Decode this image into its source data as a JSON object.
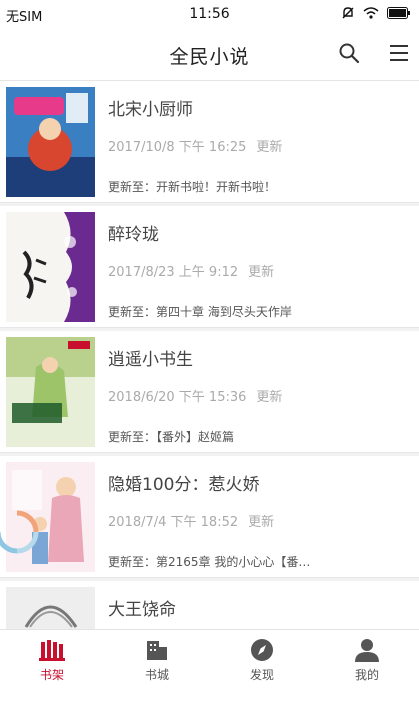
{
  "status_bar": {
    "carrier": "无SIM",
    "time": "11:56"
  },
  "header": {
    "title": "全民小说",
    "search_icon": "search-icon",
    "menu_icon": "menu-icon"
  },
  "books": [
    {
      "title": "北宋小厨师",
      "date": "2017/10/8 下午 16:25",
      "update_tag": "更新",
      "latest": "更新至：开新书啦！开新书啦！",
      "cover_color": "#d9462f"
    },
    {
      "title": "醉玲珑",
      "date": "2017/8/23 上午 9:12",
      "update_tag": "更新",
      "latest": "更新至：第四十章 海到尽头天作岸",
      "cover_color": "#6b2a8f"
    },
    {
      "title": "逍遥小书生",
      "date": "2018/6/20 下午 15:36",
      "update_tag": "更新",
      "latest": "更新至：【番外】赵姬篇",
      "cover_color": "#6f9a3a"
    },
    {
      "title": "隐婚100分：惹火娇",
      "date": "2018/7/4 下午 18:52",
      "update_tag": "更新",
      "latest": "更新至：第2165章 我的小心心【番…",
      "cover_color": "#e9a7b8"
    },
    {
      "title": "大王饶命",
      "date": "",
      "update_tag": "",
      "latest": "",
      "cover_color": "#cfcfcf"
    }
  ],
  "tabs": [
    {
      "label": "书架",
      "icon": "bookshelf-icon",
      "active": true
    },
    {
      "label": "书城",
      "icon": "bookstore-icon",
      "active": false
    },
    {
      "label": "发现",
      "icon": "compass-icon",
      "active": false
    },
    {
      "label": "我的",
      "icon": "profile-icon",
      "active": false
    }
  ],
  "colors": {
    "accent": "#c8102e",
    "text": "#444444",
    "muted": "#aaaaaa"
  }
}
